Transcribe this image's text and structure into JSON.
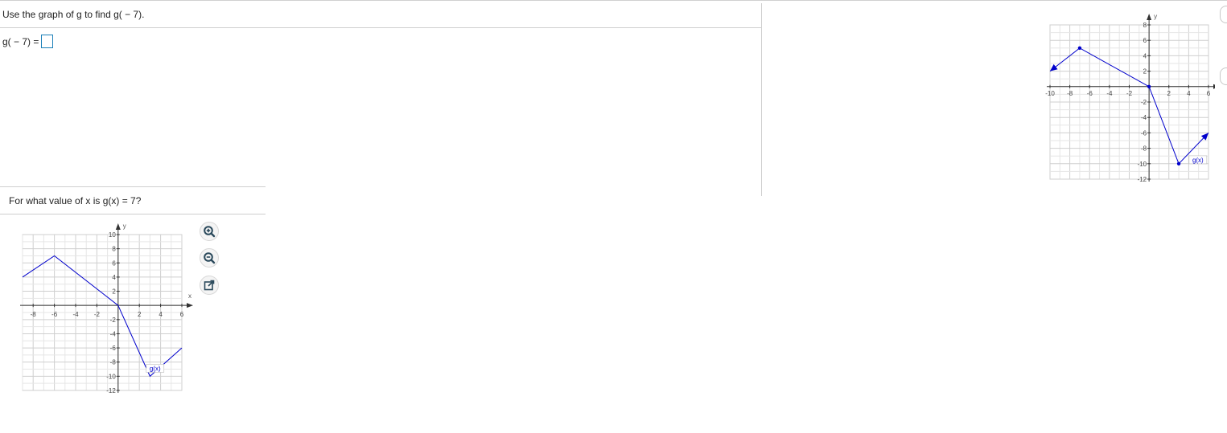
{
  "question": {
    "prompt": "Use the graph of g to find g( − 7).",
    "answer_label": "g( − 7) =",
    "answer_value": ""
  },
  "followup": {
    "prompt": "For what value of x is g(x) = 7?"
  },
  "graph_top": {
    "function_label": "g(x)",
    "x_axis_label": "x",
    "y_axis_label": "y",
    "x_ticks": [
      "-10",
      "-8",
      "-6",
      "-4",
      "-2",
      "2",
      "4",
      "6"
    ],
    "y_ticks": [
      "8",
      "6",
      "4",
      "2",
      "-2",
      "-4",
      "-6",
      "-8",
      "-10",
      "-12"
    ],
    "line_color": "#0000cc"
  },
  "graph_bottom": {
    "function_label": "g(x)",
    "x_axis_label": "x",
    "y_axis_label": "y",
    "x_ticks": [
      "-8",
      "-6",
      "-4",
      "-2",
      "2",
      "4",
      "6"
    ],
    "y_ticks": [
      "10",
      "8",
      "6",
      "4",
      "2",
      "-2",
      "-4",
      "-6",
      "-8",
      "-10",
      "-12"
    ],
    "line_color": "#0000cc"
  },
  "chart_data": [
    {
      "type": "line",
      "title": "",
      "xlabel": "x",
      "ylabel": "y",
      "xlim": [
        -10,
        6
      ],
      "ylim": [
        -12,
        8
      ],
      "grid": true,
      "series": [
        {
          "name": "g(x)",
          "x": [
            -10,
            -7,
            0,
            3,
            6
          ],
          "y": [
            2,
            5,
            0,
            -10,
            -6
          ]
        }
      ]
    },
    {
      "type": "line",
      "title": "",
      "xlabel": "x",
      "ylabel": "y",
      "xlim": [
        -9,
        6
      ],
      "ylim": [
        -12,
        10
      ],
      "grid": true,
      "series": [
        {
          "name": "g(x)",
          "x": [
            -9,
            -6,
            0,
            3,
            6
          ],
          "y": [
            4,
            7,
            0,
            -10,
            -6
          ]
        }
      ]
    }
  ],
  "tools": {
    "zoom_in": "zoom-in-icon",
    "zoom_out": "zoom-out-icon",
    "popout": "popout-icon"
  }
}
